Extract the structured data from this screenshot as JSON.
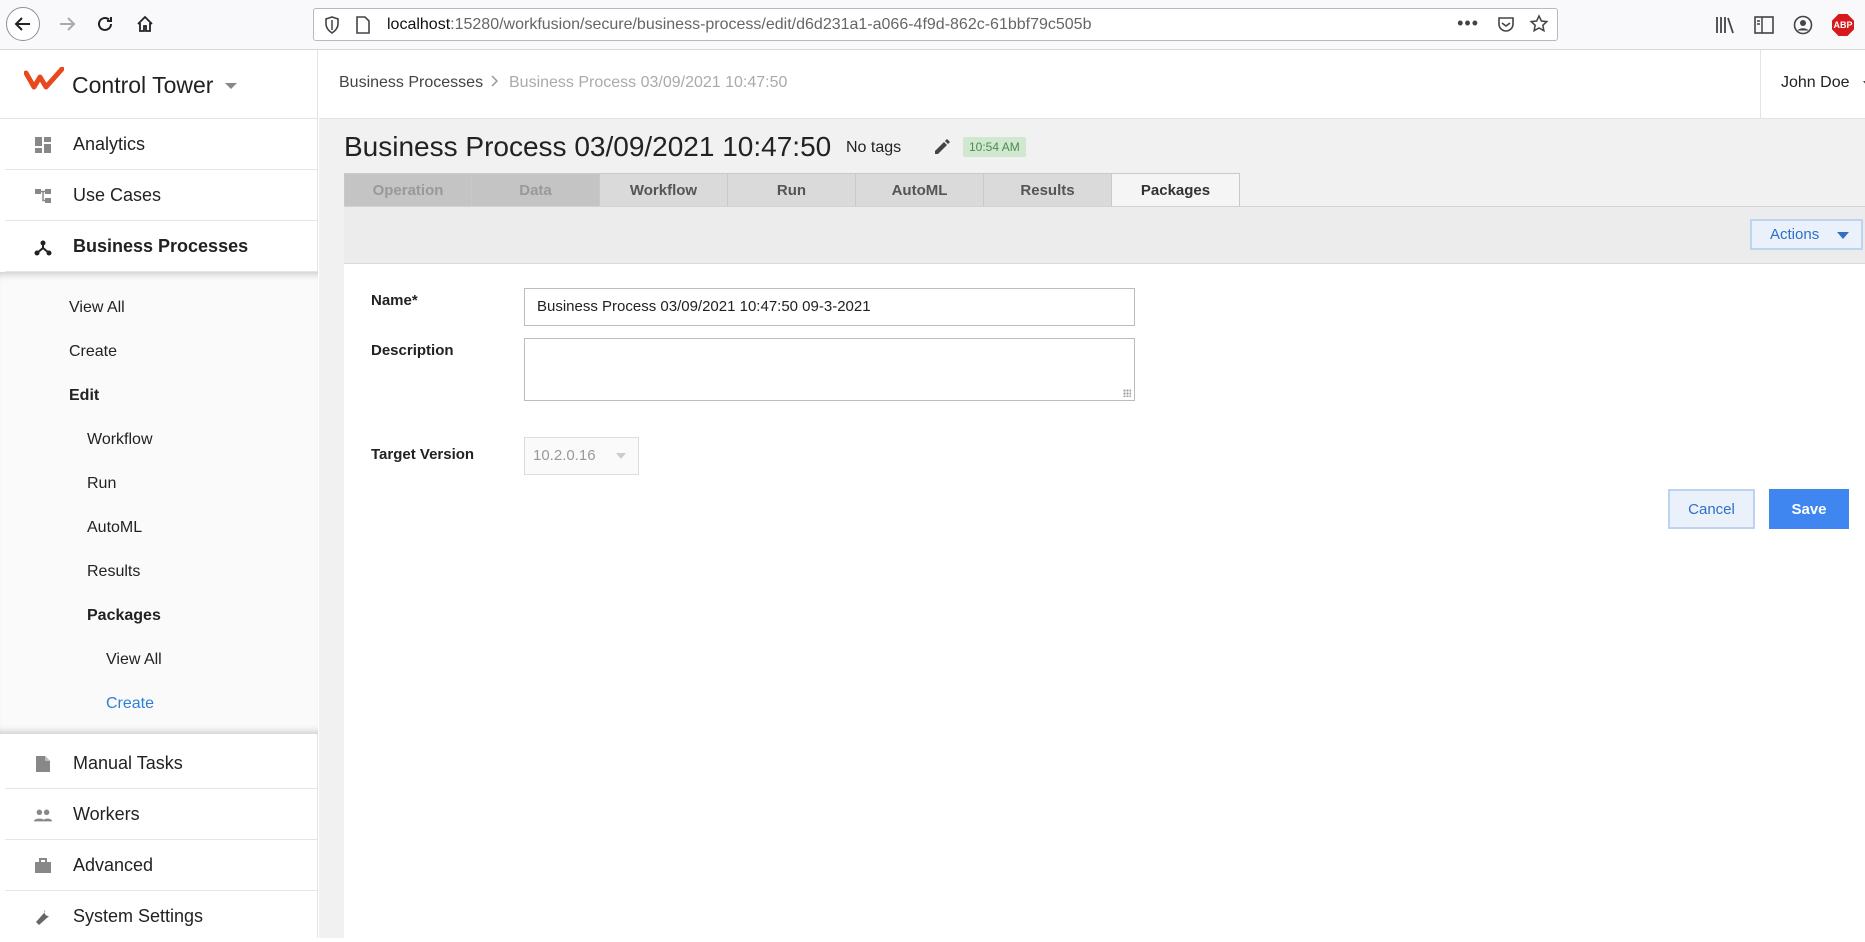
{
  "browser": {
    "url_host": "localhost",
    "url_rest": ":15280/workfusion/secure/business-process/edit/d6d231a1-a066-4f9d-862c-61bbf79c505b",
    "dots": "•••",
    "abp_label": "ABP"
  },
  "brand": {
    "name": "Control Tower",
    "color": "#e8481c"
  },
  "sidebar": {
    "items_top": [
      {
        "label": "Analytics",
        "icon": "dashboard-icon"
      },
      {
        "label": "Use Cases",
        "icon": "hierarchy-icon"
      },
      {
        "label": "Business Processes",
        "icon": "process-icon"
      }
    ],
    "sub_items": [
      {
        "label": "View All"
      },
      {
        "label": "Create"
      },
      {
        "label": "Edit"
      },
      {
        "label": "Workflow"
      },
      {
        "label": "Run"
      },
      {
        "label": "AutoML"
      },
      {
        "label": "Results"
      },
      {
        "label": "Packages"
      },
      {
        "label": "View All"
      },
      {
        "label": "Create"
      }
    ],
    "items_bottom": [
      {
        "label": "Manual Tasks",
        "icon": "document-icon"
      },
      {
        "label": "Workers",
        "icon": "people-icon"
      },
      {
        "label": "Advanced",
        "icon": "briefcase-icon"
      },
      {
        "label": "System Settings",
        "icon": "wrench-icon"
      }
    ]
  },
  "header": {
    "breadcrumb": [
      "Business Processes",
      "Business Process 03/09/2021 10:47:50"
    ],
    "breadcrumb_sep": ">",
    "user": "John Doe"
  },
  "page": {
    "title": "Business Process 03/09/2021 10:47:50",
    "tags": "No tags",
    "time_badge": "10:54 AM",
    "tabs": [
      "Operation",
      "Data",
      "Workflow",
      "Run",
      "AutoML",
      "Results",
      "Packages"
    ],
    "actions_label": "Actions"
  },
  "form": {
    "name_label": "Name*",
    "name_value": "Business Process 03/09/2021 10:47:50 09-3-2021",
    "description_label": "Description",
    "description_value": "",
    "target_version_label": "Target Version",
    "target_version_value": "10.2.0.16",
    "cancel_label": "Cancel",
    "save_label": "Save"
  },
  "colors": {
    "accent": "#3f86f1",
    "link": "#2f7fd6",
    "badge_bg": "#cfe8cf"
  }
}
